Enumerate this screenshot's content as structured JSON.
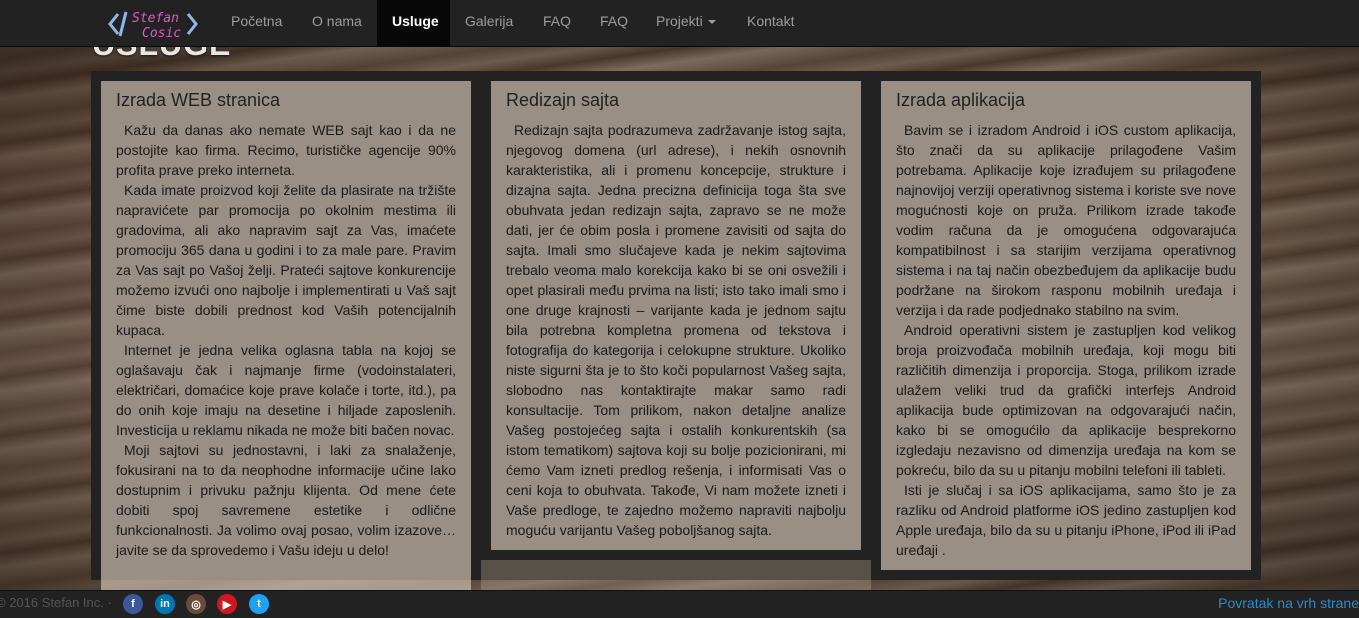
{
  "brand": {
    "line1": "Stefan",
    "line2": "Cosic"
  },
  "nav": {
    "items": [
      {
        "label": "Početna"
      },
      {
        "label": "O nama"
      },
      {
        "label": "Usluge"
      },
      {
        "label": "Galerija"
      },
      {
        "label": "FAQ"
      },
      {
        "label": "FAQ"
      },
      {
        "label": "Projekti"
      },
      {
        "label": "Kontakt"
      }
    ]
  },
  "page": {
    "heading": "USLUGE"
  },
  "cards": [
    {
      "title": "Izrada WEB stranica",
      "paragraphs": [
        "Kažu da danas ako nemate WEB sajt kao i da ne postojite kao firma. Recimo, turističke agencije 90% profita prave preko interneta.",
        "Kada imate proizvod koji želite da plasirate na tržište napravićete par promocija po okolnim mestima ili gradovima, ali ako napravim sajt za Vas, imaćete promociju 365 dana u godini i to za male pare. Pravim za Vas sajt po Vašoj želji. Prateći sajtove konkurencije možemo izvući ono najbolje i implementirati u Vaš sajt čime biste dobili prednost kod Vaših potencijalnih kupaca.",
        "Internet je jedna velika oglasna tabla na kojoj se oglašavaju čak i najmanje firme (vodoinstalateri, električari, domaćice koje prave kolače i torte, itd.), pa do onih koje imaju na desetine i hiljade zaposlenih. Investicija u reklamu nikada ne može biti bačen novac.",
        "Moji sajtovi su jednostavni, i laki za snalaženje, fokusirani na to da neophodne informacije učine lako dostupnim i privuku pažnju klijenta. Od mene ćete dobiti spoj savremene estetike i odlične funkcionalnosti. Ja volimo ovaj posao, volim izazove… javite se da sprovedemo i Vašu ideju u delo!"
      ]
    },
    {
      "title": "Redizajn sajta",
      "paragraphs": [
        "Redizajn sajta podrazumeva zadržavanje istog sajta, njegovog domena (url adrese), i nekih osnovnih karakteristika, ali i promenu koncepcije, strukture i dizajna sajta. Jedna precizna definicija toga šta sve obuhvata jedan redizajn sajta, zapravo se ne može dati, jer će obim posla i promene zavisiti od sajta do sajta. Imali smo slučajeve kada je nekim sajtovima trebalo veoma malo korekcija kako bi se oni osvežili i opet plasirali među prvima na listi; isto tako imali smo i one druge krajnosti – varijante kada je jednom sajtu bila potrebna kompletna promena od tekstova i fotografija do kategorija i celokupne strukture. Ukoliko niste sigurni šta je to što koči popularnost Vašeg sajta, slobodno nas kontaktirajte makar samo radi konsultacije. Tom prilikom, nakon detaljne analize Vašeg postojećeg sajta i ostalih konkurentskih (sa istom tematikom) sajtova koji su bolje pozicionirani, mi ćemo Vam izneti predlog rešenja, i informisati Vas o ceni koja to obuhvata. Takođe, Vi nam možete izneti i Vaše predloge, te zajedno možemo napraviti najbolju moguću varijantu Vašeg poboljšanog sajta."
      ]
    },
    {
      "title": "Izrada aplikacija",
      "paragraphs": [
        "Bavim se i izradom Android i iOS custom aplikacija, što znači da su aplikacije prilagođene Vašim potrebama. Aplikacije koje izrađujem su prilagođene najnovijoj verziji operativnog sistema i koriste sve nove mogućnosti koje on pruža. Prilikom izrade takođe vodim računa da je omogućena odgovarajuća kompatibilnost i sa starijim verzijama operativnog sistema i na taj način obezbeđujem da aplikacije budu podržane na širokom rasponu mobilnih uređaja i verzija i da rade podjednako stabilno na svim.",
        "Android operativni sistem je zastupljen kod velikog broja proizvođača mobilnih uređaja, koji mogu biti različitih dimenzija i proporcija. Stoga, prilikom izrade ulažem veliki trud da grafički interfejs Android aplikacija bude optimizovan na odgovarajući način, kako bi se omogućilo da aplikacije besprekorno izgledaju nezavisno od dimenzija uređaja na kom se pokreću, bilo da su u pitanju mobilni telefoni ili tableti.",
        "Isti je slučaj i sa iOS aplikacijama, samo što je za razliku od Android platforme iOS jedino zastupljen kod Apple uređaja, bilo da su u pitanju iPhone, iPod ili iPad uređaji ."
      ]
    }
  ],
  "footer": {
    "copyright": "© 2016 Stefan Inc. ·",
    "social": [
      {
        "icon": "facebook-icon",
        "glyph": "f",
        "color": "#3b5998"
      },
      {
        "icon": "linkedin-icon",
        "glyph": "in",
        "color": "#0077b5"
      },
      {
        "icon": "instagram-icon",
        "glyph": "◎",
        "color": "#6d4b3a"
      },
      {
        "icon": "youtube-icon",
        "glyph": "▶",
        "color": "#cc181e"
      },
      {
        "icon": "twitter-icon",
        "glyph": "t",
        "color": "#1da1f2"
      }
    ],
    "back_to_top": "Povratak na vrh strane"
  },
  "colors": {
    "navbar": "#222222",
    "link": "#2a8bd0",
    "brand_accent": "#8fb8e8",
    "brand_pink": "#e05ac8"
  }
}
